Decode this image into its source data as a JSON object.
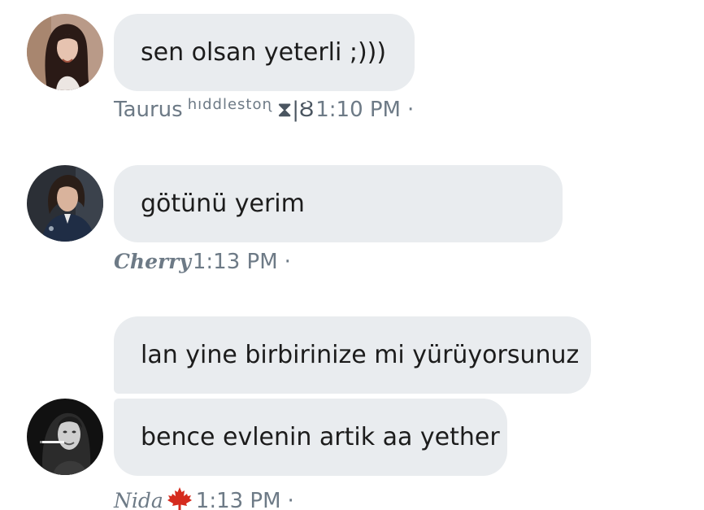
{
  "messages": [
    {
      "sender": "Taurus",
      "sender_suffix": "hıddlestoɳ",
      "sender_glyphs": "⧗|Ȣ",
      "text": "sen olsan yeterli ;)))",
      "time": "1:10 PM",
      "separator": "·"
    },
    {
      "sender": "Cherry",
      "text": "götünü yerim",
      "time": "1:13 PM",
      "separator": "·"
    },
    {
      "sender": "Nida",
      "sender_icon": "maple-leaf-icon",
      "texts": [
        "lan yine birbirinize mi yürüyorsunuz",
        "bence evlenin artik aa yether"
      ],
      "time": "1:13 PM",
      "separator": "·"
    }
  ],
  "colors": {
    "bubble": "#e9ecef",
    "meta_text": "#6d7a86",
    "maple_leaf": "#d52b1e"
  }
}
